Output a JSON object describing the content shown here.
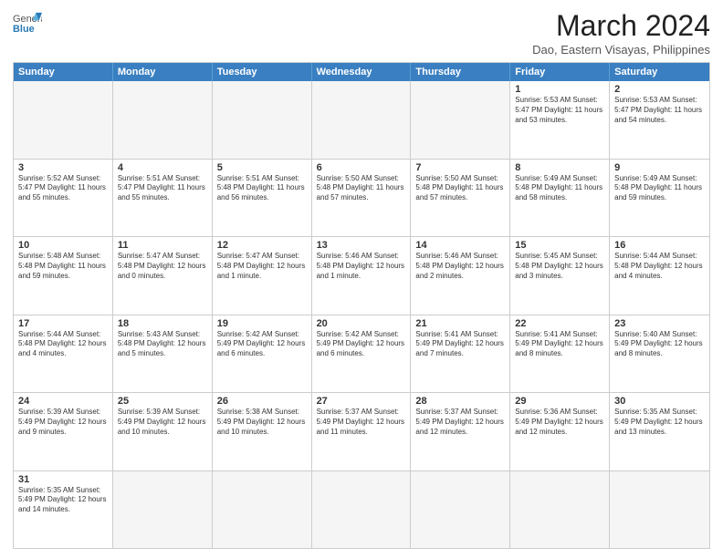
{
  "header": {
    "logo_general": "General",
    "logo_blue": "Blue",
    "month_title": "March 2024",
    "location": "Dao, Eastern Visayas, Philippines"
  },
  "days_of_week": [
    "Sunday",
    "Monday",
    "Tuesday",
    "Wednesday",
    "Thursday",
    "Friday",
    "Saturday"
  ],
  "weeks": [
    [
      {
        "day": "",
        "info": ""
      },
      {
        "day": "",
        "info": ""
      },
      {
        "day": "",
        "info": ""
      },
      {
        "day": "",
        "info": ""
      },
      {
        "day": "",
        "info": ""
      },
      {
        "day": "1",
        "info": "Sunrise: 5:53 AM\nSunset: 5:47 PM\nDaylight: 11 hours\nand 53 minutes."
      },
      {
        "day": "2",
        "info": "Sunrise: 5:53 AM\nSunset: 5:47 PM\nDaylight: 11 hours\nand 54 minutes."
      }
    ],
    [
      {
        "day": "3",
        "info": "Sunrise: 5:52 AM\nSunset: 5:47 PM\nDaylight: 11 hours\nand 55 minutes."
      },
      {
        "day": "4",
        "info": "Sunrise: 5:51 AM\nSunset: 5:47 PM\nDaylight: 11 hours\nand 55 minutes."
      },
      {
        "day": "5",
        "info": "Sunrise: 5:51 AM\nSunset: 5:48 PM\nDaylight: 11 hours\nand 56 minutes."
      },
      {
        "day": "6",
        "info": "Sunrise: 5:50 AM\nSunset: 5:48 PM\nDaylight: 11 hours\nand 57 minutes."
      },
      {
        "day": "7",
        "info": "Sunrise: 5:50 AM\nSunset: 5:48 PM\nDaylight: 11 hours\nand 57 minutes."
      },
      {
        "day": "8",
        "info": "Sunrise: 5:49 AM\nSunset: 5:48 PM\nDaylight: 11 hours\nand 58 minutes."
      },
      {
        "day": "9",
        "info": "Sunrise: 5:49 AM\nSunset: 5:48 PM\nDaylight: 11 hours\nand 59 minutes."
      }
    ],
    [
      {
        "day": "10",
        "info": "Sunrise: 5:48 AM\nSunset: 5:48 PM\nDaylight: 11 hours\nand 59 minutes."
      },
      {
        "day": "11",
        "info": "Sunrise: 5:47 AM\nSunset: 5:48 PM\nDaylight: 12 hours\nand 0 minutes."
      },
      {
        "day": "12",
        "info": "Sunrise: 5:47 AM\nSunset: 5:48 PM\nDaylight: 12 hours\nand 1 minute."
      },
      {
        "day": "13",
        "info": "Sunrise: 5:46 AM\nSunset: 5:48 PM\nDaylight: 12 hours\nand 1 minute."
      },
      {
        "day": "14",
        "info": "Sunrise: 5:46 AM\nSunset: 5:48 PM\nDaylight: 12 hours\nand 2 minutes."
      },
      {
        "day": "15",
        "info": "Sunrise: 5:45 AM\nSunset: 5:48 PM\nDaylight: 12 hours\nand 3 minutes."
      },
      {
        "day": "16",
        "info": "Sunrise: 5:44 AM\nSunset: 5:48 PM\nDaylight: 12 hours\nand 4 minutes."
      }
    ],
    [
      {
        "day": "17",
        "info": "Sunrise: 5:44 AM\nSunset: 5:48 PM\nDaylight: 12 hours\nand 4 minutes."
      },
      {
        "day": "18",
        "info": "Sunrise: 5:43 AM\nSunset: 5:48 PM\nDaylight: 12 hours\nand 5 minutes."
      },
      {
        "day": "19",
        "info": "Sunrise: 5:42 AM\nSunset: 5:49 PM\nDaylight: 12 hours\nand 6 minutes."
      },
      {
        "day": "20",
        "info": "Sunrise: 5:42 AM\nSunset: 5:49 PM\nDaylight: 12 hours\nand 6 minutes."
      },
      {
        "day": "21",
        "info": "Sunrise: 5:41 AM\nSunset: 5:49 PM\nDaylight: 12 hours\nand 7 minutes."
      },
      {
        "day": "22",
        "info": "Sunrise: 5:41 AM\nSunset: 5:49 PM\nDaylight: 12 hours\nand 8 minutes."
      },
      {
        "day": "23",
        "info": "Sunrise: 5:40 AM\nSunset: 5:49 PM\nDaylight: 12 hours\nand 8 minutes."
      }
    ],
    [
      {
        "day": "24",
        "info": "Sunrise: 5:39 AM\nSunset: 5:49 PM\nDaylight: 12 hours\nand 9 minutes."
      },
      {
        "day": "25",
        "info": "Sunrise: 5:39 AM\nSunset: 5:49 PM\nDaylight: 12 hours\nand 10 minutes."
      },
      {
        "day": "26",
        "info": "Sunrise: 5:38 AM\nSunset: 5:49 PM\nDaylight: 12 hours\nand 10 minutes."
      },
      {
        "day": "27",
        "info": "Sunrise: 5:37 AM\nSunset: 5:49 PM\nDaylight: 12 hours\nand 11 minutes."
      },
      {
        "day": "28",
        "info": "Sunrise: 5:37 AM\nSunset: 5:49 PM\nDaylight: 12 hours\nand 12 minutes."
      },
      {
        "day": "29",
        "info": "Sunrise: 5:36 AM\nSunset: 5:49 PM\nDaylight: 12 hours\nand 12 minutes."
      },
      {
        "day": "30",
        "info": "Sunrise: 5:35 AM\nSunset: 5:49 PM\nDaylight: 12 hours\nand 13 minutes."
      }
    ],
    [
      {
        "day": "31",
        "info": "Sunrise: 5:35 AM\nSunset: 5:49 PM\nDaylight: 12 hours\nand 14 minutes."
      },
      {
        "day": "",
        "info": ""
      },
      {
        "day": "",
        "info": ""
      },
      {
        "day": "",
        "info": ""
      },
      {
        "day": "",
        "info": ""
      },
      {
        "day": "",
        "info": ""
      },
      {
        "day": "",
        "info": ""
      }
    ]
  ]
}
